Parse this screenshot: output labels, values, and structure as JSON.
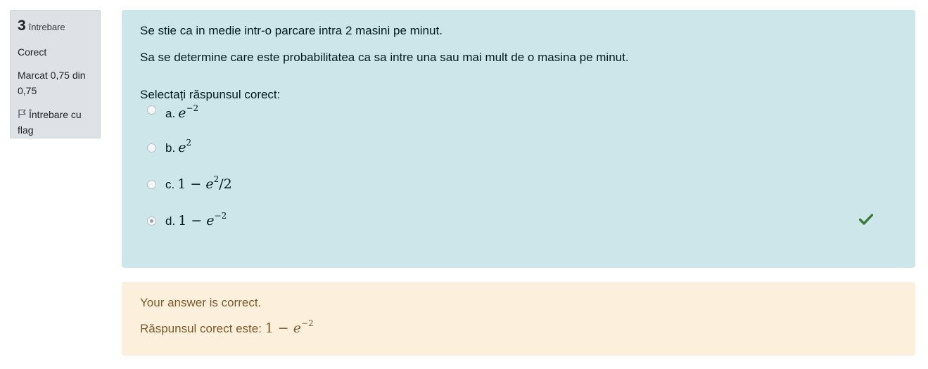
{
  "info": {
    "question_number": "3",
    "question_word": "întrebare",
    "state": "Corect",
    "grade": "Marcat 0,75 din 0,75",
    "flag_label": "Întrebare cu flag"
  },
  "question": {
    "text_1": "Se stie ca in medie intr-o parcare intra 2 masini pe minut.",
    "text_2": "Sa se determine care este probabilitatea  ca sa intre una sau  mai mult de o masina pe minut.",
    "prompt": "Selectați răspunsul corect:",
    "options": [
      {
        "letter": "a.",
        "base": "e",
        "exp": "−2",
        "prefix": "",
        "suffix": "",
        "selected": false
      },
      {
        "letter": "b.",
        "base": "e",
        "exp": "2",
        "prefix": "",
        "suffix": "",
        "selected": false
      },
      {
        "letter": "c.",
        "base": "e",
        "exp": "2",
        "prefix": "1 − ",
        "suffix": "/2",
        "selected": false
      },
      {
        "letter": "d.",
        "base": "e",
        "exp": "−2",
        "prefix": "1 − ",
        "suffix": "",
        "selected": true
      }
    ],
    "correct_icon": "check-icon"
  },
  "feedback": {
    "result": "Your answer is correct.",
    "right_answer_label": "Răspunsul corect este:",
    "right_answer": {
      "prefix": "1 − ",
      "base": "e",
      "exp": "−2"
    }
  },
  "colors": {
    "question_bg": "#cce6ea",
    "feedback_bg": "#fcefdc",
    "info_bg": "#dee2e6",
    "correct_check": "#357a32"
  }
}
